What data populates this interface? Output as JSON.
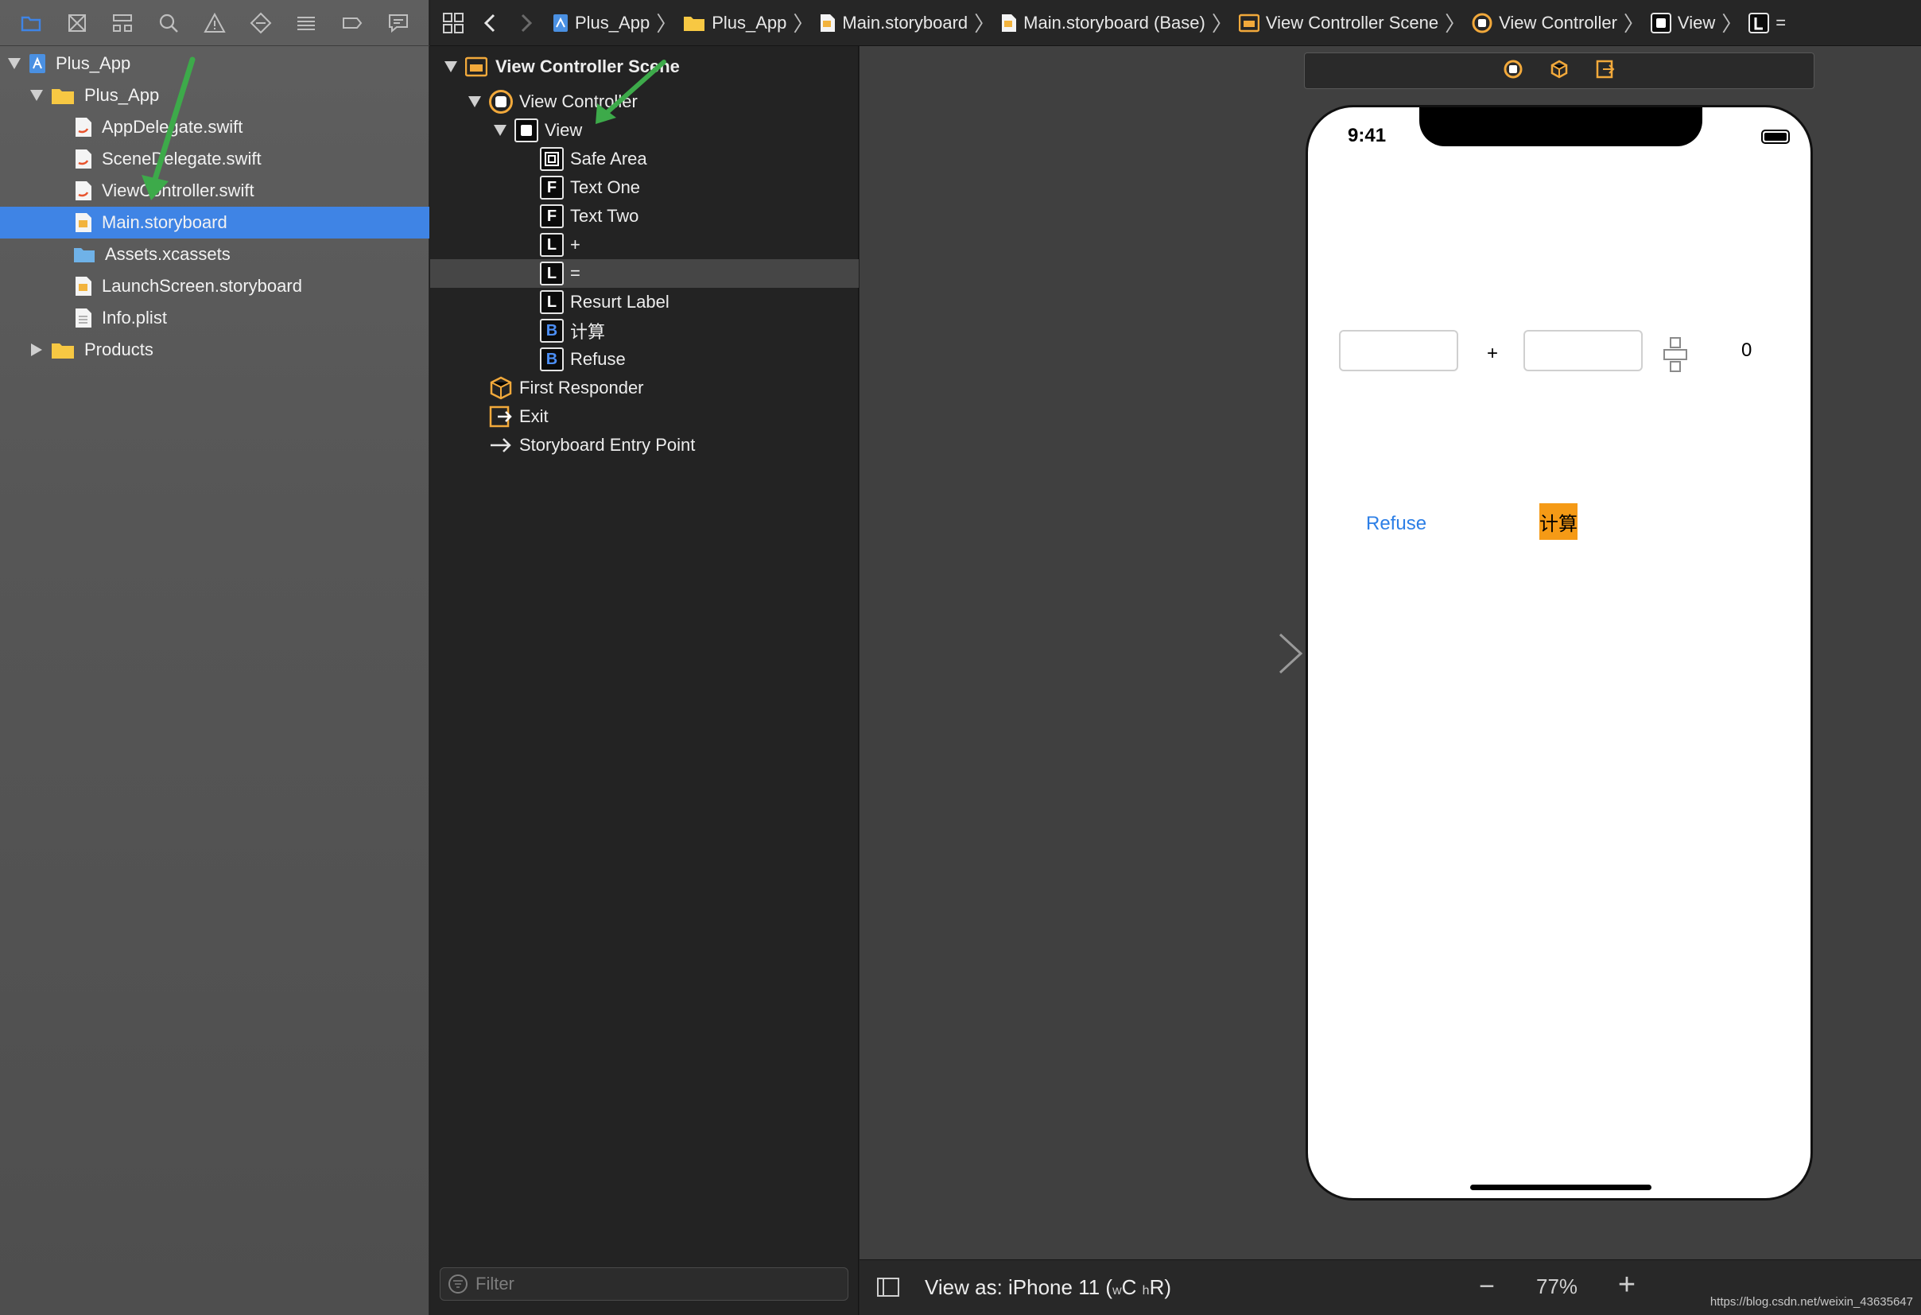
{
  "navigator": {
    "tools": [
      "folder-icon",
      "source-control-icon",
      "hierarchy-icon",
      "search-icon",
      "warning-icon",
      "test-icon",
      "debug-icon",
      "breakpoint-icon",
      "report-icon"
    ],
    "tree": [
      {
        "label": "Plus_App",
        "kind": "project",
        "expanded": true
      },
      {
        "label": "Plus_App",
        "kind": "folder",
        "expanded": true
      },
      {
        "label": "AppDelegate.swift",
        "kind": "swift"
      },
      {
        "label": "SceneDelegate.swift",
        "kind": "swift"
      },
      {
        "label": "ViewController.swift",
        "kind": "swift"
      },
      {
        "label": "Main.storyboard",
        "kind": "storyboard",
        "selected": true
      },
      {
        "label": "Assets.xcassets",
        "kind": "assets"
      },
      {
        "label": "LaunchScreen.storyboard",
        "kind": "storyboard"
      },
      {
        "label": "Info.plist",
        "kind": "plist"
      },
      {
        "label": "Products",
        "kind": "folder",
        "expanded": false
      }
    ]
  },
  "jumpbar": {
    "crumbs": [
      "Plus_App",
      "Plus_App",
      "Main.storyboard",
      "Main.storyboard (Base)",
      "View Controller Scene",
      "View Controller",
      "View",
      "="
    ]
  },
  "outline": {
    "scene_title": "View Controller Scene",
    "items": [
      {
        "label": "View Controller",
        "icon": "view-controller"
      },
      {
        "label": "View",
        "icon": "view"
      },
      {
        "label": "Safe Area",
        "icon": "safe-area"
      },
      {
        "label": "Text One",
        "icon": "F"
      },
      {
        "label": "Text Two",
        "icon": "F"
      },
      {
        "label": "+",
        "icon": "L"
      },
      {
        "label": "=",
        "icon": "L",
        "selected": true
      },
      {
        "label": "Resurt Label",
        "icon": "L"
      },
      {
        "label": "计算",
        "icon": "B"
      },
      {
        "label": "Refuse",
        "icon": "B"
      },
      {
        "label": "First Responder",
        "icon": "first-responder"
      },
      {
        "label": "Exit",
        "icon": "exit"
      },
      {
        "label": "Storyboard Entry Point",
        "icon": "arrow"
      }
    ],
    "filter_placeholder": "Filter"
  },
  "device": {
    "time": "9:41",
    "plus_label": "+",
    "result_label": "0",
    "refuse_button": "Refuse",
    "calc_button": "计算"
  },
  "bottombar": {
    "view_as_prefix": "View as: iPhone 11 (",
    "w": "w",
    "c": "C",
    "h": "h",
    "r": "R",
    "close": ")",
    "zoom": "77%"
  },
  "watermark": "https://blog.csdn.net/weixin_43635647",
  "colors": {
    "selection": "#3f84e5",
    "calc_button": "#f59a16",
    "link_blue": "#2d7fe6",
    "arrow_green": "#3daa4a"
  }
}
